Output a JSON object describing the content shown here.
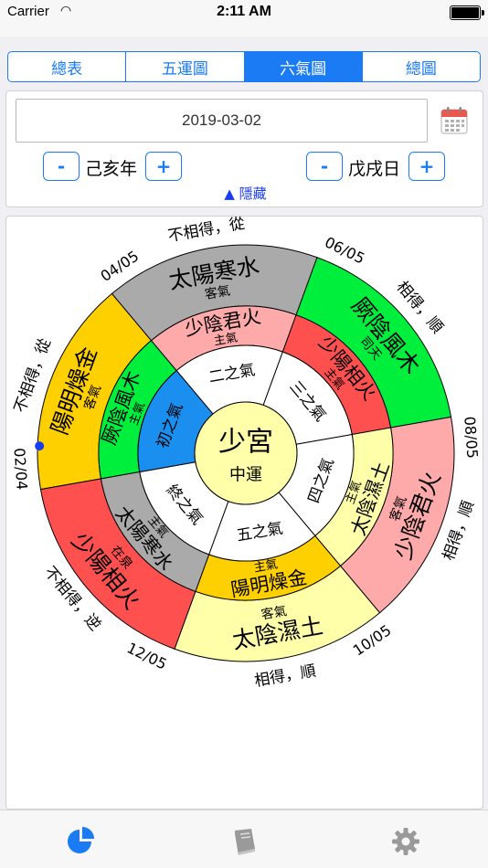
{
  "status": {
    "carrier": "Carrier",
    "time": "2:11 AM"
  },
  "tabs": [
    {
      "label": "總表",
      "active": false
    },
    {
      "label": "五運圖",
      "active": false
    },
    {
      "label": "六氣圖",
      "active": true
    },
    {
      "label": "總圖",
      "active": false
    }
  ],
  "date": {
    "value": "2019-03-02"
  },
  "year_stepper": {
    "minus": "-",
    "label": "己亥年",
    "plus": "+"
  },
  "day_stepper": {
    "minus": "-",
    "label": "戊戌日",
    "plus": "+"
  },
  "hide_toggle": "▲ 隱藏",
  "wheel": {
    "center": {
      "main": "少宮",
      "sub": "中運"
    },
    "inner_qi": [
      "初之氣",
      "二之氣",
      "三之氣",
      "四之氣",
      "五之氣",
      "終之氣"
    ],
    "main_qi": [
      {
        "name": "厥陰風木",
        "tag": "主氣",
        "color": "#00ee3c"
      },
      {
        "name": "少陰君火",
        "tag": "主氣",
        "color": "#ffaaaa"
      },
      {
        "name": "少陽相火",
        "tag": "主氣",
        "color": "#ff5050"
      },
      {
        "name": "太陰濕土",
        "tag": "主氣",
        "color": "#ffffaa"
      },
      {
        "name": "陽明燥金",
        "tag": "主氣",
        "color": "#ffd000"
      },
      {
        "name": "太陽寒水",
        "tag": "主氣",
        "color": "#aaaaaa"
      }
    ],
    "guest_qi": [
      {
        "name": "陽明燥金",
        "tag": "客氣",
        "color": "#ffd000"
      },
      {
        "name": "太陽寒水",
        "tag": "客氣",
        "color": "#aaaaaa"
      },
      {
        "name": "厥陰風木",
        "tag": "司天",
        "color": "#00ee3c"
      },
      {
        "name": "少陰君火",
        "tag": "客氣",
        "color": "#ffaaaa"
      },
      {
        "name": "太陰濕土",
        "tag": "客氣",
        "color": "#ffffaa"
      },
      {
        "name": "少陽相火",
        "tag": "在泉",
        "color": "#ff5050"
      }
    ],
    "relations": [
      "不相得，從",
      "不相得，從",
      "相得，順",
      "相得，順",
      "相得，順",
      "不相得，逆"
    ],
    "dates": [
      "02/04",
      "04/05",
      "06/05",
      "08/05",
      "10/05",
      "12/05"
    ]
  }
}
